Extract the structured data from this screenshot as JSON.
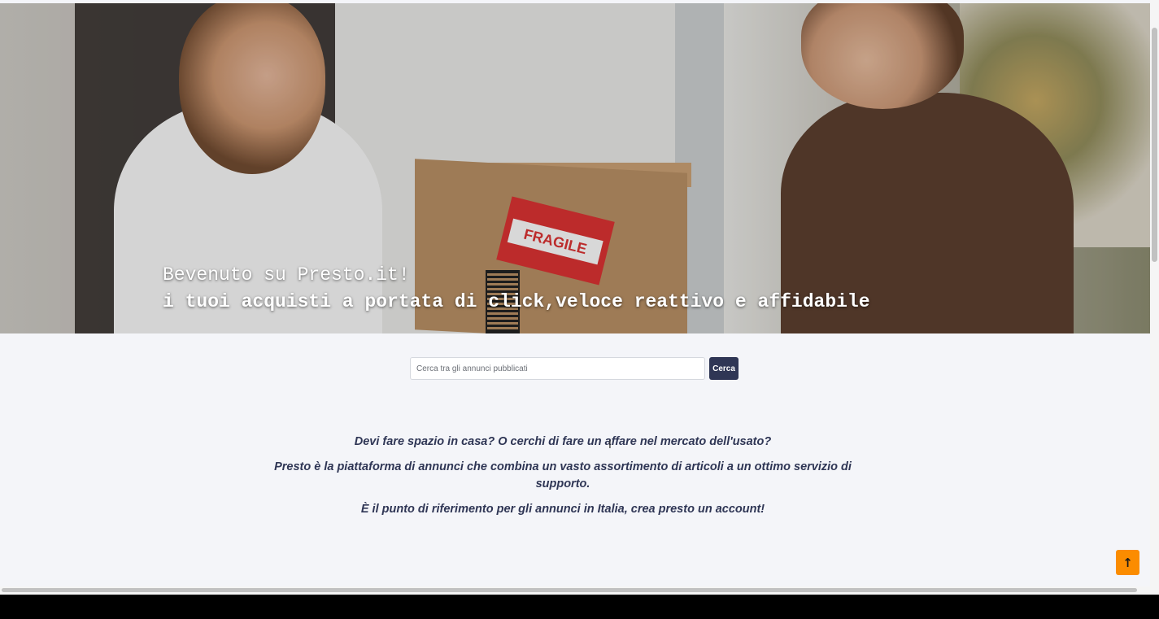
{
  "hero": {
    "line1": "Bevenuto su Presto.it!",
    "line2": "i tuoi acquisti a portata di click,veloce reattivo e affidabile",
    "package_label": "FRAGILE"
  },
  "search": {
    "placeholder": "Cerca tra gli annunci pubblicati",
    "button_label": "Cerca"
  },
  "about": {
    "p1": "Devi fare spazio in casa? O cerchi di fare un affare nel mercato dell'usato?",
    "p2": "Presto è la piattaforma di annunci che combina un vasto assortimento di articoli a un ottimo servizio di supporto.",
    "p3": "È il punto di riferimento per gli annunci in Italia, crea presto un account!"
  },
  "back_to_top": {
    "icon": "arrow-up-icon",
    "glyph": "↑"
  },
  "colors": {
    "page_background": "#f4f5f9",
    "primary": "#2f3655",
    "accent": "#fb8c00"
  }
}
